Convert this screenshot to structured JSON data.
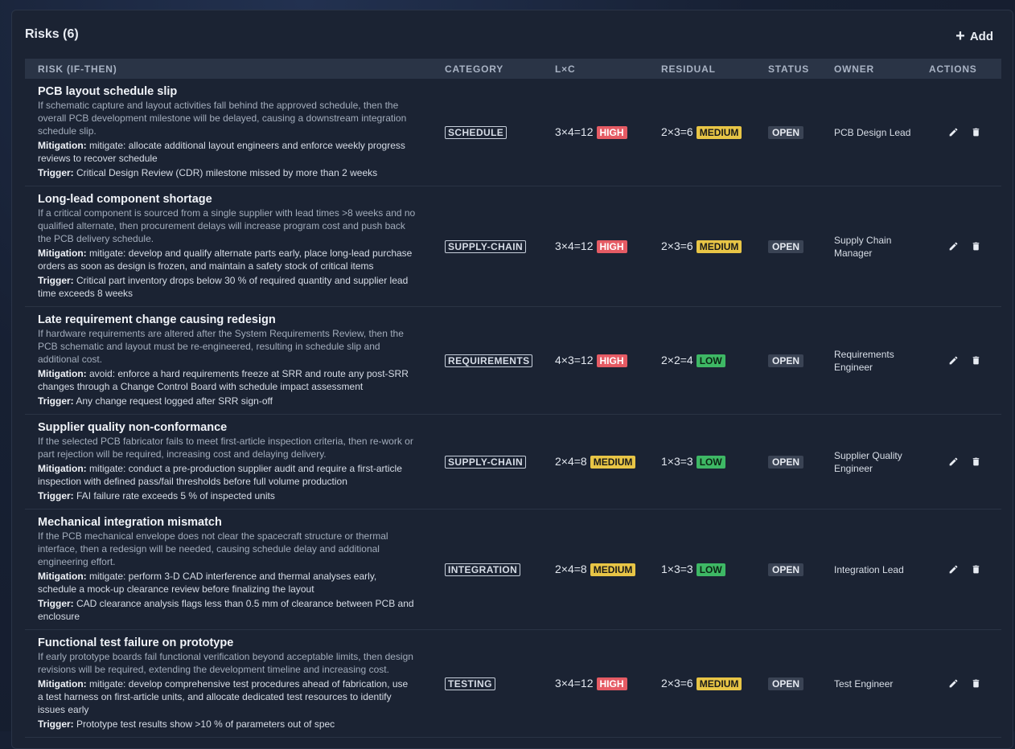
{
  "panel": {
    "title": "Risks (6)",
    "add_label": "Add"
  },
  "table": {
    "headers": {
      "risk": "RISK (IF-THEN)",
      "category": "CATEGORY",
      "lxc": "L×C",
      "residual": "RESIDUAL",
      "status": "STATUS",
      "owner": "OWNER",
      "actions": "ACTIONS"
    },
    "mitigation_label": "Mitigation:",
    "trigger_label": "Trigger:",
    "rows": [
      {
        "title": "PCB layout schedule slip",
        "description": "If schematic capture and layout activities fall behind the approved schedule, then the overall PCB development milestone will be delayed, causing a downstream integration schedule slip.",
        "mitigation": "mitigate: allocate additional layout engineers and enforce weekly progress reviews to recover schedule",
        "trigger": "Critical Design Review (CDR) milestone missed by more than 2 weeks",
        "category": "SCHEDULE",
        "lxc": "3×4=12",
        "lxc_level": "HIGH",
        "residual": "2×3=6",
        "residual_level": "MEDIUM",
        "status": "OPEN",
        "owner": "PCB Design Lead"
      },
      {
        "title": "Long-lead component shortage",
        "description": "If a critical component is sourced from a single supplier with lead times >8 weeks and no qualified alternate, then procurement delays will increase program cost and push back the PCB delivery schedule.",
        "mitigation": "mitigate: develop and qualify alternate parts early, place long-lead purchase orders as soon as design is frozen, and maintain a safety stock of critical items",
        "trigger": "Critical part inventory drops below 30 % of required quantity and supplier lead time exceeds 8 weeks",
        "category": "SUPPLY-CHAIN",
        "lxc": "3×4=12",
        "lxc_level": "HIGH",
        "residual": "2×3=6",
        "residual_level": "MEDIUM",
        "status": "OPEN",
        "owner": "Supply Chain Manager"
      },
      {
        "title": "Late requirement change causing redesign",
        "description": "If hardware requirements are altered after the System Requirements Review, then the PCB schematic and layout must be re-engineered, resulting in schedule slip and additional cost.",
        "mitigation": "avoid: enforce a hard requirements freeze at SRR and route any post-SRR changes through a Change Control Board with schedule impact assessment",
        "trigger": "Any change request logged after SRR sign-off",
        "category": "REQUIREMENTS",
        "lxc": "4×3=12",
        "lxc_level": "HIGH",
        "residual": "2×2=4",
        "residual_level": "LOW",
        "status": "OPEN",
        "owner": "Requirements Engineer"
      },
      {
        "title": "Supplier quality non-conformance",
        "description": "If the selected PCB fabricator fails to meet first-article inspection criteria, then re-work or part rejection will be required, increasing cost and delaying delivery.",
        "mitigation": "mitigate: conduct a pre-production supplier audit and require a first-article inspection with defined pass/fail thresholds before full volume production",
        "trigger": "FAI failure rate exceeds 5 % of inspected units",
        "category": "SUPPLY-CHAIN",
        "lxc": "2×4=8",
        "lxc_level": "MEDIUM",
        "residual": "1×3=3",
        "residual_level": "LOW",
        "status": "OPEN",
        "owner": "Supplier Quality Engineer"
      },
      {
        "title": "Mechanical integration mismatch",
        "description": "If the PCB mechanical envelope does not clear the spacecraft structure or thermal interface, then a redesign will be needed, causing schedule delay and additional engineering effort.",
        "mitigation": "mitigate: perform 3-D CAD interference and thermal analyses early, schedule a mock-up clearance review before finalizing the layout",
        "trigger": "CAD clearance analysis flags less than 0.5 mm of clearance between PCB and enclosure",
        "category": "INTEGRATION",
        "lxc": "2×4=8",
        "lxc_level": "MEDIUM",
        "residual": "1×3=3",
        "residual_level": "LOW",
        "status": "OPEN",
        "owner": "Integration Lead"
      },
      {
        "title": "Functional test failure on prototype",
        "description": "If early prototype boards fail functional verification beyond acceptable limits, then design revisions will be required, extending the development timeline and increasing cost.",
        "mitigation": "mitigate: develop comprehensive test procedures ahead of fabrication, use a test harness on first-article units, and allocate dedicated test resources to identify issues early",
        "trigger": "Prototype test results show >10 % of parameters out of spec",
        "category": "TESTING",
        "lxc": "3×4=12",
        "lxc_level": "HIGH",
        "residual": "2×3=6",
        "residual_level": "MEDIUM",
        "status": "OPEN",
        "owner": "Test Engineer"
      }
    ]
  },
  "icons": {
    "add": "plus-icon",
    "edit": "pencil-icon",
    "delete": "trash-icon"
  },
  "colors": {
    "high": "#e55b64",
    "medium": "#e8c546",
    "low": "#3eb865"
  }
}
